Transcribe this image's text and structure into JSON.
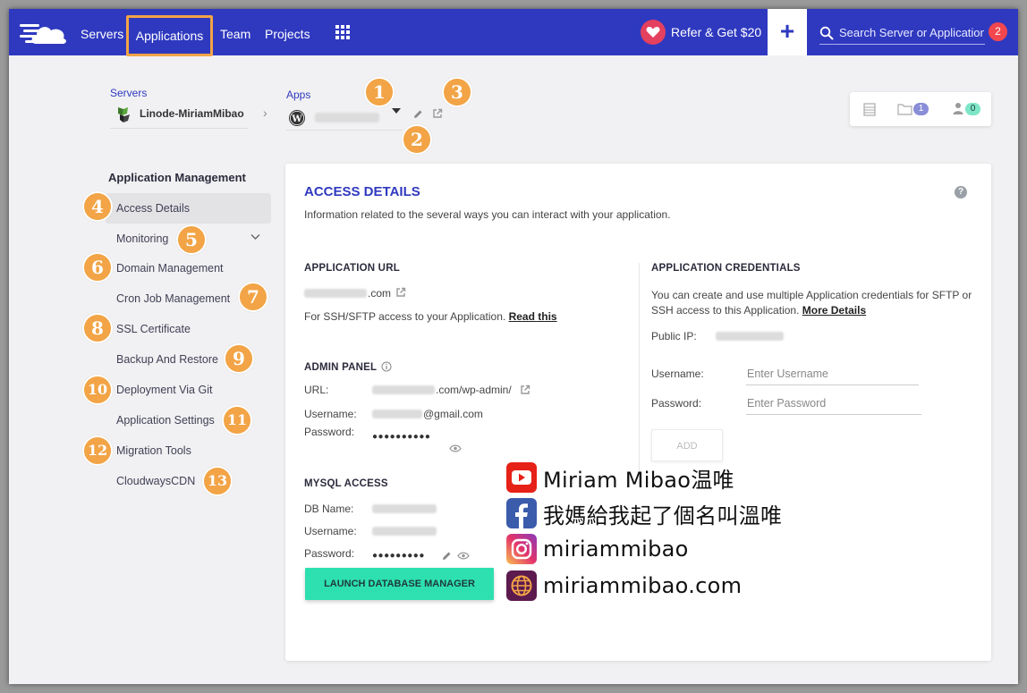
{
  "nav": {
    "servers": "Servers",
    "applications": "Applications",
    "team": "Team",
    "projects": "Projects",
    "refer": "Refer & Get $20",
    "plus": "+",
    "search_placeholder": "Search Server or Application",
    "notif_count": "2"
  },
  "breadcrumb": {
    "servers_label": "Servers",
    "server_name": "Linode-MiriamMibao",
    "apps_label": "Apps"
  },
  "stats": {
    "folders": "1",
    "members": "0"
  },
  "sidebar": {
    "title": "Application Management",
    "items": [
      "Access Details",
      "Monitoring",
      "Domain Management",
      "Cron Job Management",
      "SSL Certificate",
      "Backup And Restore",
      "Deployment Via Git",
      "Application Settings",
      "Migration Tools",
      "CloudwaysCDN"
    ]
  },
  "badges": [
    "1",
    "2",
    "3",
    "4",
    "5",
    "6",
    "7",
    "8",
    "9",
    "10",
    "11",
    "12",
    "13"
  ],
  "card": {
    "title": "ACCESS DETAILS",
    "subtitle": "Information related to the several ways you can interact with your application.",
    "help": "?"
  },
  "app_url": {
    "head": "APPLICATION URL",
    "domain_suffix": ".com",
    "ssh_text": "For SSH/SFTP access to your Application.",
    "ssh_link": "Read this"
  },
  "admin": {
    "head": "ADMIN PANEL",
    "url_label": "URL:",
    "url_suffix": ".com/wp-admin/",
    "username_label": "Username:",
    "username_suffix": "@gmail.com",
    "password_label": "Password:",
    "password_mask": "●●●●●●●●●●"
  },
  "mysql": {
    "head": "MYSQL ACCESS",
    "db_label": "DB Name:",
    "username_label": "Username:",
    "password_label": "Password:",
    "password_mask": "●●●●●●●●●",
    "launch": "LAUNCH DATABASE MANAGER"
  },
  "creds": {
    "head": "APPLICATION CREDENTIALS",
    "desc": "You can create and use multiple Application credentials for SFTP or SSH access to this Application.",
    "more": "More Details",
    "public_ip_label": "Public IP:",
    "username_label": "Username:",
    "username_placeholder": "Enter Username",
    "password_label": "Password:",
    "password_placeholder": "Enter Password",
    "add": "ADD"
  },
  "social": {
    "youtube": "Miriam Mibao温唯",
    "facebook": "我媽給我起了個名叫溫唯",
    "instagram": "miriammibao",
    "web": "miriammibao.com"
  },
  "colors": {
    "brand": "#2f39bf",
    "accent": "#f2a446",
    "launch": "#2ee0b0"
  }
}
